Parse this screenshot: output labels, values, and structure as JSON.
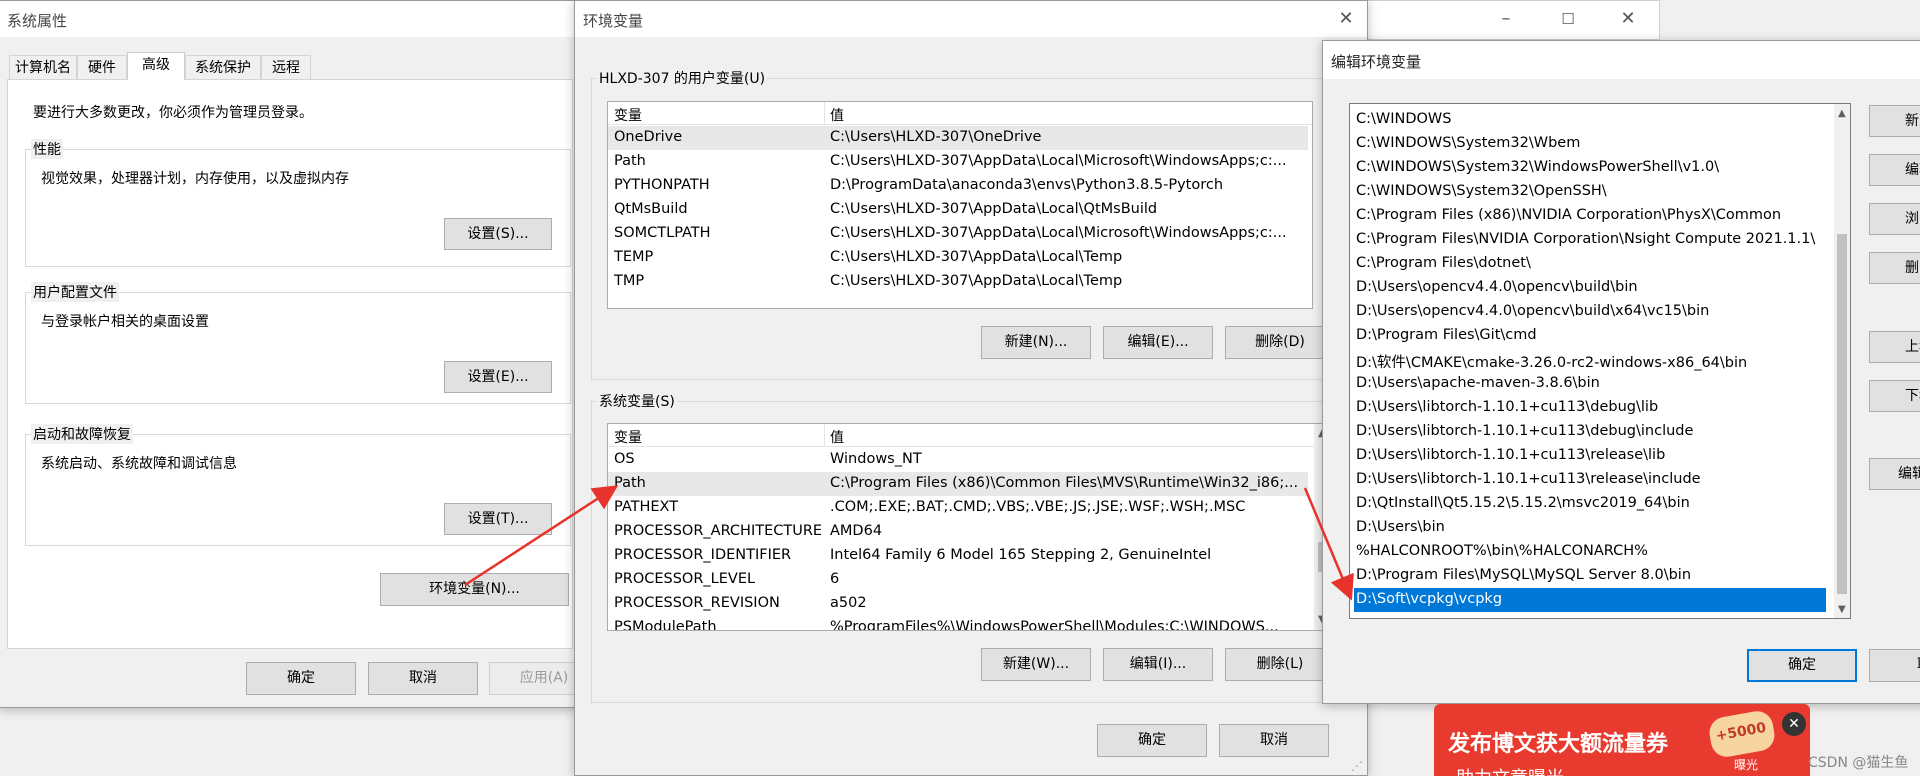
{
  "system_properties": {
    "title": "系统属性",
    "tabs": [
      "计算机名",
      "硬件",
      "高级",
      "系统保护",
      "远程"
    ],
    "admin_note": "要进行大多数更改，你必须作为管理员登录。",
    "performance": {
      "label": "性能",
      "desc": "视觉效果，处理器计划，内存使用，以及虚拟内存",
      "button": "设置(S)..."
    },
    "user_profile": {
      "label": "用户配置文件",
      "desc": "与登录帐户相关的桌面设置",
      "button": "设置(E)..."
    },
    "startup": {
      "label": "启动和故障恢复",
      "desc": "系统启动、系统故障和调试信息",
      "button": "设置(T)..."
    },
    "env_button": "环境变量(N)...",
    "ok": "确定",
    "cancel": "取消",
    "apply": "应用(A)"
  },
  "env_vars": {
    "title": "环境变量",
    "user_group_label": "HLXD-307 的用户变量(U)",
    "col_var": "变量",
    "col_val": "值",
    "user_vars": [
      {
        "name": "OneDrive",
        "value": "C:\\Users\\HLXD-307\\OneDrive"
      },
      {
        "name": "Path",
        "value": "C:\\Users\\HLXD-307\\AppData\\Local\\Microsoft\\WindowsApps;c:..."
      },
      {
        "name": "PYTHONPATH",
        "value": "D:\\ProgramData\\anaconda3\\envs\\Python3.8.5-Pytorch"
      },
      {
        "name": "QtMsBuild",
        "value": "C:\\Users\\HLXD-307\\AppData\\Local\\QtMsBuild"
      },
      {
        "name": "SOMCTLPATH",
        "value": "C:\\Users\\HLXD-307\\AppData\\Local\\Microsoft\\WindowsApps;c:..."
      },
      {
        "name": "TEMP",
        "value": "C:\\Users\\HLXD-307\\AppData\\Local\\Temp"
      },
      {
        "name": "TMP",
        "value": "C:\\Users\\HLXD-307\\AppData\\Local\\Temp"
      }
    ],
    "user_new": "新建(N)...",
    "user_edit": "编辑(E)...",
    "user_delete": "删除(D)",
    "sys_group_label": "系统变量(S)",
    "sys_vars": [
      {
        "name": "OS",
        "value": "Windows_NT"
      },
      {
        "name": "Path",
        "value": "C:\\Program Files (x86)\\Common Files\\MVS\\Runtime\\Win32_i86;..."
      },
      {
        "name": "PATHEXT",
        "value": ".COM;.EXE;.BAT;.CMD;.VBS;.VBE;.JS;.JSE;.WSF;.WSH;.MSC"
      },
      {
        "name": "PROCESSOR_ARCHITECTURE",
        "value": "AMD64"
      },
      {
        "name": "PROCESSOR_IDENTIFIER",
        "value": "Intel64 Family 6 Model 165 Stepping 2, GenuineIntel"
      },
      {
        "name": "PROCESSOR_LEVEL",
        "value": "6"
      },
      {
        "name": "PROCESSOR_REVISION",
        "value": "a502"
      },
      {
        "name": "PSModulePath",
        "value": "%ProgramFiles%\\WindowsPowerShell\\Modules;C:\\WINDOWS..."
      }
    ],
    "sys_new": "新建(W)...",
    "sys_edit": "编辑(I)...",
    "sys_delete": "删除(L)",
    "ok": "确定",
    "cancel": "取消"
  },
  "edit_env": {
    "title": "编辑环境变量",
    "entries": [
      "C:\\WINDOWS",
      "C:\\WINDOWS\\System32\\Wbem",
      "C:\\WINDOWS\\System32\\WindowsPowerShell\\v1.0\\",
      "C:\\WINDOWS\\System32\\OpenSSH\\",
      "C:\\Program Files (x86)\\NVIDIA Corporation\\PhysX\\Common",
      "C:\\Program Files\\NVIDIA Corporation\\Nsight Compute 2021.1.1\\",
      "C:\\Program Files\\dotnet\\",
      "D:\\Users\\opencv4.4.0\\opencv\\build\\bin",
      "D:\\Users\\opencv4.4.0\\opencv\\build\\x64\\vc15\\bin",
      "D:\\Program Files\\Git\\cmd",
      "D:\\软件\\CMAKE\\cmake-3.26.0-rc2-windows-x86_64\\bin",
      "D:\\Users\\apache-maven-3.8.6\\bin",
      "D:\\Users\\libtorch-1.10.1+cu113\\debug\\lib",
      "D:\\Users\\libtorch-1.10.1+cu113\\debug\\include",
      "D:\\Users\\libtorch-1.10.1+cu113\\release\\lib",
      "D:\\Users\\libtorch-1.10.1+cu113\\release\\include",
      "D:\\QtInstall\\Qt5.15.2\\5.15.2\\msvc2019_64\\bin",
      "D:\\Users\\bin",
      "%HALCONROOT%\\bin\\%HALCONARCH%",
      "D:\\Program Files\\MySQL\\MySQL Server 8.0\\bin",
      "D:\\Soft\\vcpkg\\vcpkg"
    ],
    "side_buttons": [
      "新建",
      "编辑",
      "浏览",
      "删除",
      "上移",
      "下移",
      "编辑文"
    ],
    "ok": "确定",
    "cancel": "取"
  },
  "banner": {
    "text": "发布博文获大额流量券",
    "badge": "+5000",
    "sub": "曝光",
    "below": "助力文章曝光"
  },
  "watermark": "CSDN @猫生鱼",
  "colors": {
    "selection": "#0078d7",
    "arrow": "#e8322c",
    "banner": "#e83a2e"
  }
}
